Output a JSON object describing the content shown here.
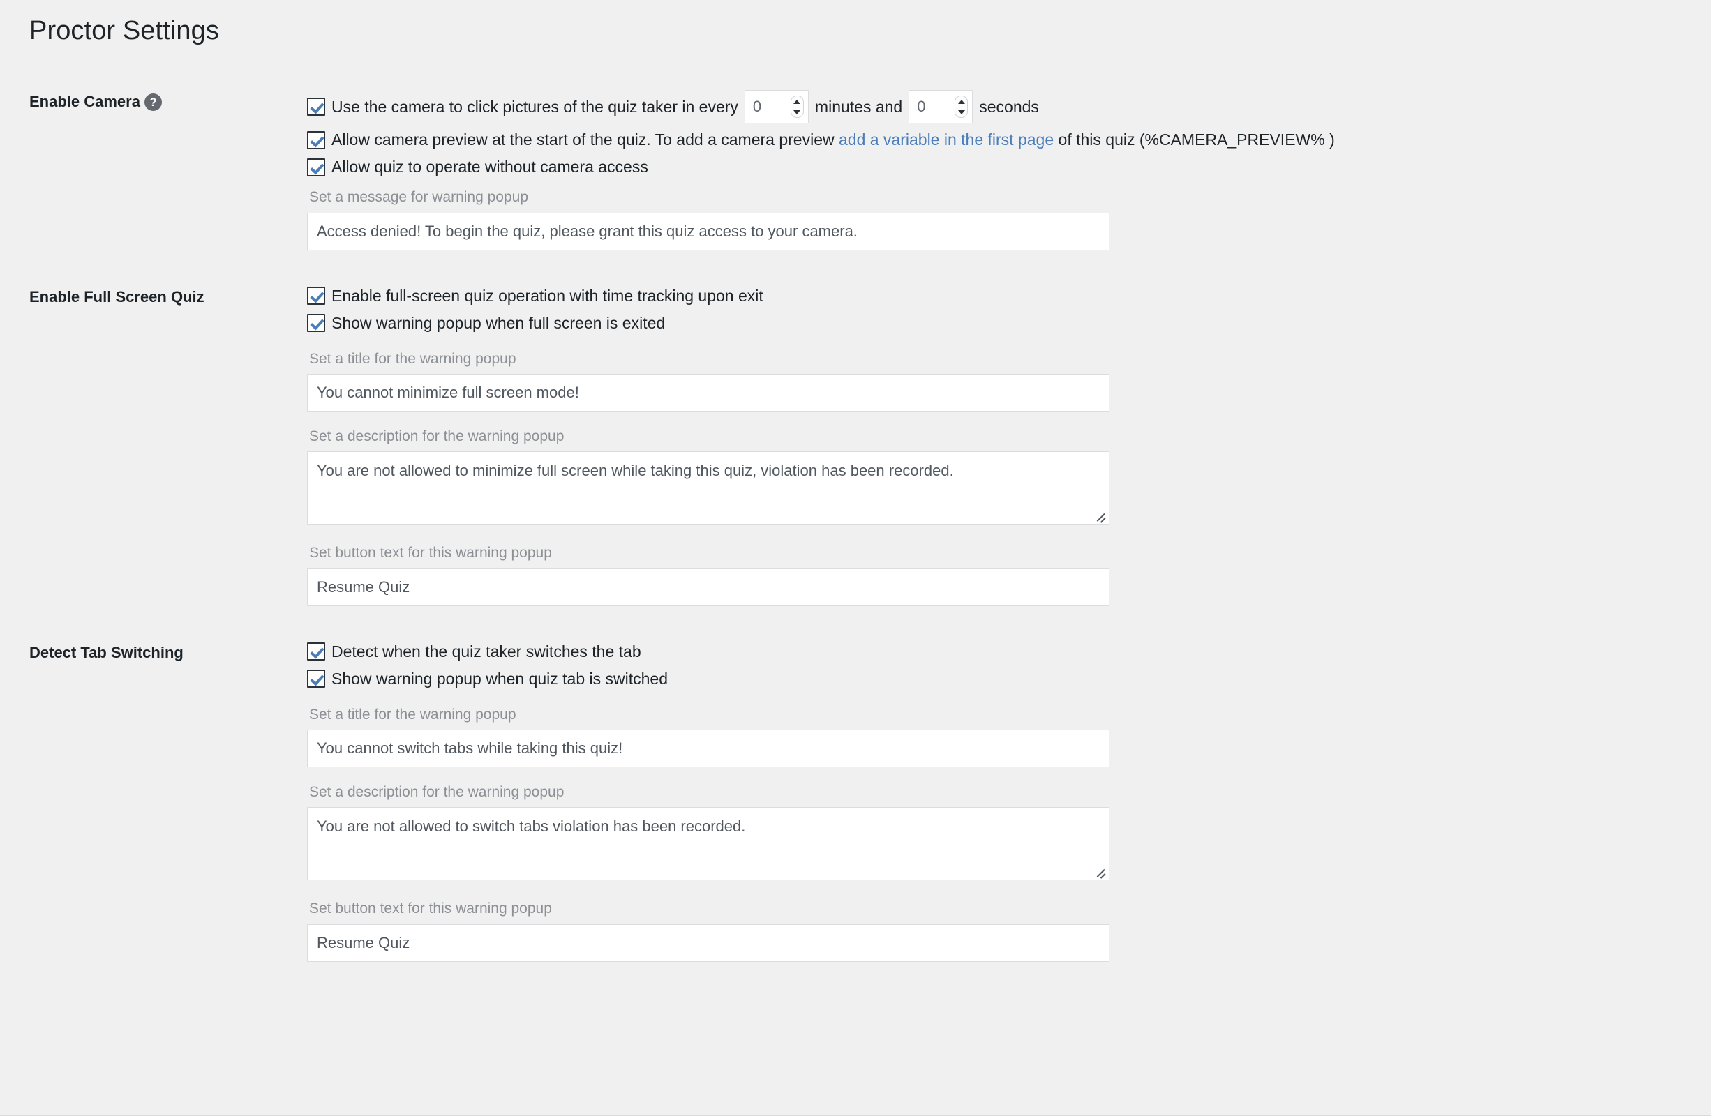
{
  "page": {
    "title": "Proctor Settings"
  },
  "icons": {
    "help": "?",
    "spinner_up": "chevron-up-icon",
    "spinner_down": "chevron-down-icon"
  },
  "colors": {
    "background": "#f0f0f1",
    "text": "#1d2327",
    "muted_label": "#8c8f94",
    "link": "#4a7ebb",
    "checkbox_check": "#4a7ebb",
    "input_border": "#dcdcde"
  },
  "sections": [
    {
      "id": "enable-camera",
      "label": "Enable Camera",
      "has_help_icon": true,
      "checkboxes": [
        {
          "id": "use-camera-interval",
          "checked": true,
          "text_before": "Use the camera to click pictures of the quiz taker in every",
          "minutes_value": "0",
          "text_middle": "minutes and",
          "seconds_value": "0",
          "text_after": "seconds"
        },
        {
          "id": "allow-camera-preview",
          "checked": true,
          "text_before": "Allow camera preview at the start of the quiz. To add a camera preview",
          "link_text": "add a variable in the first page",
          "text_after": "of this quiz (%CAMERA_PREVIEW% )"
        },
        {
          "id": "allow-without-camera",
          "checked": true,
          "text": "Allow quiz to operate without camera access"
        }
      ],
      "fields": [
        {
          "id": "camera-warning-message",
          "label": "Set a message for warning popup",
          "type": "text",
          "value": "Access denied! To begin the quiz, please grant this quiz access to your camera."
        }
      ]
    },
    {
      "id": "enable-full-screen-quiz",
      "label": "Enable Full Screen Quiz",
      "has_help_icon": false,
      "checkboxes": [
        {
          "id": "enable-fullscreen",
          "checked": true,
          "text": "Enable full-screen quiz operation with time tracking upon exit"
        },
        {
          "id": "show-fullscreen-warning",
          "checked": true,
          "text": "Show warning popup when full screen is exited"
        }
      ],
      "fields": [
        {
          "id": "fullscreen-warning-title",
          "label": "Set a title for the warning popup",
          "type": "text",
          "value": "You cannot minimize full screen mode!"
        },
        {
          "id": "fullscreen-warning-description",
          "label": "Set a description for the warning popup",
          "type": "textarea",
          "value": "You are not allowed to minimize full screen while taking this quiz, violation has been recorded."
        },
        {
          "id": "fullscreen-warning-button",
          "label": "Set button text for this warning popup",
          "type": "text",
          "value": "Resume Quiz"
        }
      ]
    },
    {
      "id": "detect-tab-switching",
      "label": "Detect Tab Switching",
      "has_help_icon": false,
      "checkboxes": [
        {
          "id": "detect-tab-switch",
          "checked": true,
          "text": "Detect when the quiz taker switches the tab"
        },
        {
          "id": "show-tab-warning",
          "checked": true,
          "text": "Show warning popup when quiz tab is switched"
        }
      ],
      "fields": [
        {
          "id": "tab-warning-title",
          "label": "Set a title for the warning popup",
          "type": "text",
          "value": "You cannot switch tabs while taking this quiz!"
        },
        {
          "id": "tab-warning-description",
          "label": "Set a description for the warning popup",
          "type": "textarea",
          "value": "You are not allowed to switch tabs violation has been recorded."
        },
        {
          "id": "tab-warning-button",
          "label": "Set button text for this warning popup",
          "type": "text",
          "value": "Resume Quiz"
        }
      ]
    }
  ]
}
